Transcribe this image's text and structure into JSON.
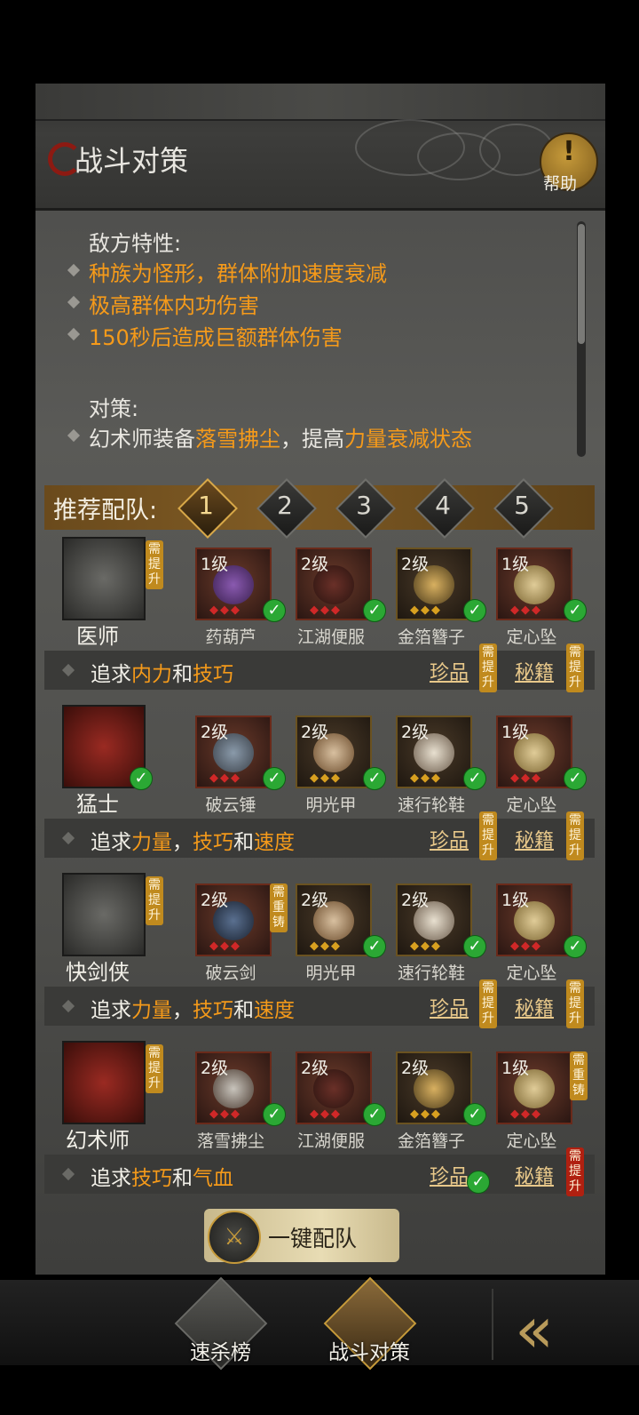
{
  "header": {
    "title": "战斗对策",
    "help_label": "帮助",
    "help_mark": "!"
  },
  "enemy": {
    "heading": "敌方特性:",
    "traits": [
      "种族为怪形，群体附加速度衰减",
      "极高群体内功伤害",
      "150秒后造成巨额群体伤害"
    ]
  },
  "strategy": {
    "heading": "对策:",
    "line_pre": "幻术师装备",
    "line_item": "落雪拂尘",
    "line_mid": "，提高",
    "line_stat": "力量衰减状态"
  },
  "recommend": {
    "label": "推荐配队:",
    "tabs": [
      "1",
      "2",
      "3",
      "4",
      "5"
    ],
    "active_tab": "1"
  },
  "roles": [
    {
      "name": "医师",
      "tag": "需提升",
      "equips": [
        {
          "lv": "1级",
          "name": "药葫芦"
        },
        {
          "lv": "2级",
          "name": "江湖便服"
        },
        {
          "lv": "2级",
          "name": "金箔簪子"
        },
        {
          "lv": "1级",
          "name": "定心坠"
        }
      ],
      "pursue": {
        "pre": "追求",
        "a": "内力",
        "mid": "和",
        "b": "技巧",
        "sep": "",
        "c": "",
        "post": ""
      }
    },
    {
      "name": "猛士",
      "tag": "",
      "equips": [
        {
          "lv": "2级",
          "name": "破云锤"
        },
        {
          "lv": "2级",
          "name": "明光甲"
        },
        {
          "lv": "2级",
          "name": "速行轮鞋"
        },
        {
          "lv": "1级",
          "name": "定心坠"
        }
      ],
      "pursue": {
        "pre": "追求",
        "a": "力量",
        "mid": "，",
        "b": "技巧",
        "sep": "和",
        "c": "速度",
        "post": ""
      }
    },
    {
      "name": "快剑侠",
      "tag": "需提升",
      "equips": [
        {
          "lv": "2级",
          "name": "破云剑",
          "tag": "需重铸"
        },
        {
          "lv": "2级",
          "name": "明光甲"
        },
        {
          "lv": "2级",
          "name": "速行轮鞋"
        },
        {
          "lv": "1级",
          "name": "定心坠"
        }
      ],
      "pursue": {
        "pre": "追求",
        "a": "力量",
        "mid": "，",
        "b": "技巧",
        "sep": "和",
        "c": "速度",
        "post": ""
      }
    },
    {
      "name": "幻术师",
      "tag": "需提升",
      "equips": [
        {
          "lv": "2级",
          "name": "落雪拂尘"
        },
        {
          "lv": "2级",
          "name": "江湖便服"
        },
        {
          "lv": "2级",
          "name": "金箔簪子"
        },
        {
          "lv": "1级",
          "name": "定心坠",
          "tag": "需重铸"
        }
      ],
      "pursue": {
        "pre": "追求",
        "a": "技巧",
        "mid": "和",
        "b": "气血",
        "sep": "",
        "c": "",
        "post": ""
      }
    }
  ],
  "links": {
    "treasure": "珍品",
    "manual": "秘籍"
  },
  "tags": {
    "need_upgrade": "需提升",
    "need_recast": "需重铸"
  },
  "one_key": {
    "label": "一键配队"
  },
  "bottom_nav": {
    "kill_rank": "速杀榜",
    "battle_strategy": "战斗对策"
  },
  "colors": {
    "accent": "#f59a1a",
    "gold": "#c08a1e",
    "check": "#2ba834",
    "alert": "#b02010"
  }
}
